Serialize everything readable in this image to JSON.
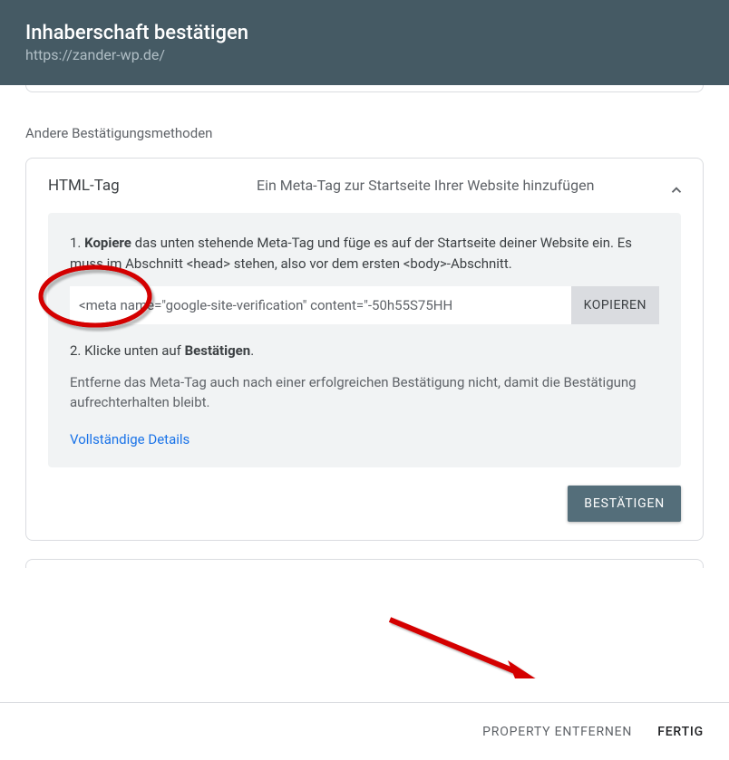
{
  "header": {
    "title": "Inhaberschaft bestätigen",
    "url": "https://zander-wp.de/"
  },
  "section_label": "Andere Bestätigungsmethoden",
  "method": {
    "name": "HTML-Tag",
    "desc": "Ein Meta-Tag zur Startseite Ihrer Website hinzufügen"
  },
  "instructions": {
    "step1_num": "1. ",
    "step1_bold": "Kopiere",
    "step1_rest_a": " das unten stehende Meta-Tag und füge es auf der Startseite deiner Website ein. Es muss im Abschnitt ",
    "step1_head": "<head>",
    "step1_rest_b": " stehen, also vor dem ersten ",
    "step1_body": "<body>",
    "step1_rest_c": "-Abschnitt.",
    "meta_tag": "<meta name=\"google-site-verification\" content=\"-50h55S75HH",
    "copy_label": "KOPIEREN",
    "step2_a": "2. Klicke unten auf ",
    "step2_bold": "Bestätigen",
    "step2_b": ".",
    "note": "Entferne das Meta-Tag auch nach einer erfolgreichen Bestätigung nicht, damit die Bestätigung aufrechterhalten bleibt.",
    "details_link": "Vollständige Details"
  },
  "verify_label": "BESTÄTIGEN",
  "footer": {
    "remove": "PROPERTY ENTFERNEN",
    "done": "FERTIG"
  }
}
